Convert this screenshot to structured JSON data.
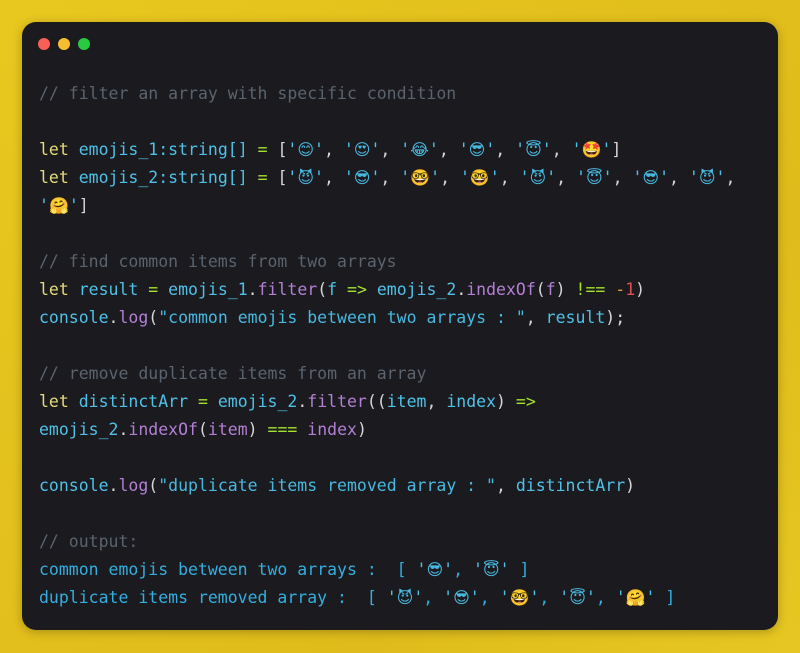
{
  "window": {
    "frame_color": "#e5c320",
    "card_color": "#1b1b1f",
    "dots": [
      {
        "name": "close",
        "color": "#fa5f57"
      },
      {
        "name": "minimize",
        "color": "#f5bd2f"
      },
      {
        "name": "maximize",
        "color": "#29ca41"
      }
    ]
  },
  "theme": {
    "comment": "#5a636e",
    "keyword": "#e6db74",
    "variable": "#4fc1e9",
    "operator": "#a6e22e",
    "function": "#b37fd4",
    "string": "#47b8e0",
    "number": "#e05252",
    "punctuation": "#d6d6d6"
  },
  "code": {
    "language": "typescript",
    "comment_1": "// filter an array with specific condition",
    "comment_2": "// find common items from two arrays",
    "comment_3": "// remove duplicate items from an array",
    "comment_4": "// output:",
    "kw_let": "let",
    "var_emojis_1": "emojis_1",
    "var_emojis_2": "emojis_2",
    "var_result": "result",
    "var_distinct": "distinctArr",
    "type_string_array": ":string[]",
    "op_assign": "=",
    "op_arrow": "=>",
    "op_strict_neq": "!==",
    "op_strict_eq": "===",
    "obj_console": "console",
    "fn_log": "log",
    "fn_filter": "filter",
    "fn_indexof": "indexOf",
    "param_f": "f",
    "param_item": "item",
    "param_index": "index",
    "num_minus": "-",
    "num_one": "1",
    "str_common": "\"common emojis between two arrays : \"",
    "str_duplicate": "\"duplicate items removed array : \"",
    "emojis_1_values": [
      "😊",
      "😍",
      "😂",
      "😎",
      "😇",
      "🤩"
    ],
    "emojis_2_values": [
      "😈",
      "😎",
      "🤓",
      "🤓",
      "😈",
      "😇",
      "😎",
      "😈",
      "🤗"
    ],
    "output_line_1_label": "common emojis between two arrays :",
    "output_line_1_values": [
      "😎",
      "😇"
    ],
    "output_line_2_label": "duplicate items removed array :",
    "output_line_2_values": [
      "😈",
      "😎",
      "🤓",
      "😇",
      "🤗"
    ],
    "lines": [
      "// filter an array with specific condition",
      "",
      "let emojis_1:string[] = ['😊', '😍', '😂', '😎', '😇', '🤩']",
      "let emojis_2:string[] = ['😈', '😎', '🤓', '🤓', '😈', '😇', '😎', '😈', '🤗']",
      "",
      "// find common items from two arrays",
      "let result = emojis_1.filter(f => emojis_2.indexOf(f) !== -1)",
      "console.log(\"common emojis between two arrays : \", result);",
      "",
      "// remove duplicate items from an array",
      "let distinctArr = emojis_2.filter((item, index) => emojis_2.indexOf(item) === index)",
      "",
      "console.log(\"duplicate items removed array : \", distinctArr)",
      "",
      "// output:",
      "common emojis between two arrays :  [ '😎', '😇' ]",
      "duplicate items removed array :  [ '😈', '😎', '🤓', '😇', '🤗' ]"
    ]
  }
}
